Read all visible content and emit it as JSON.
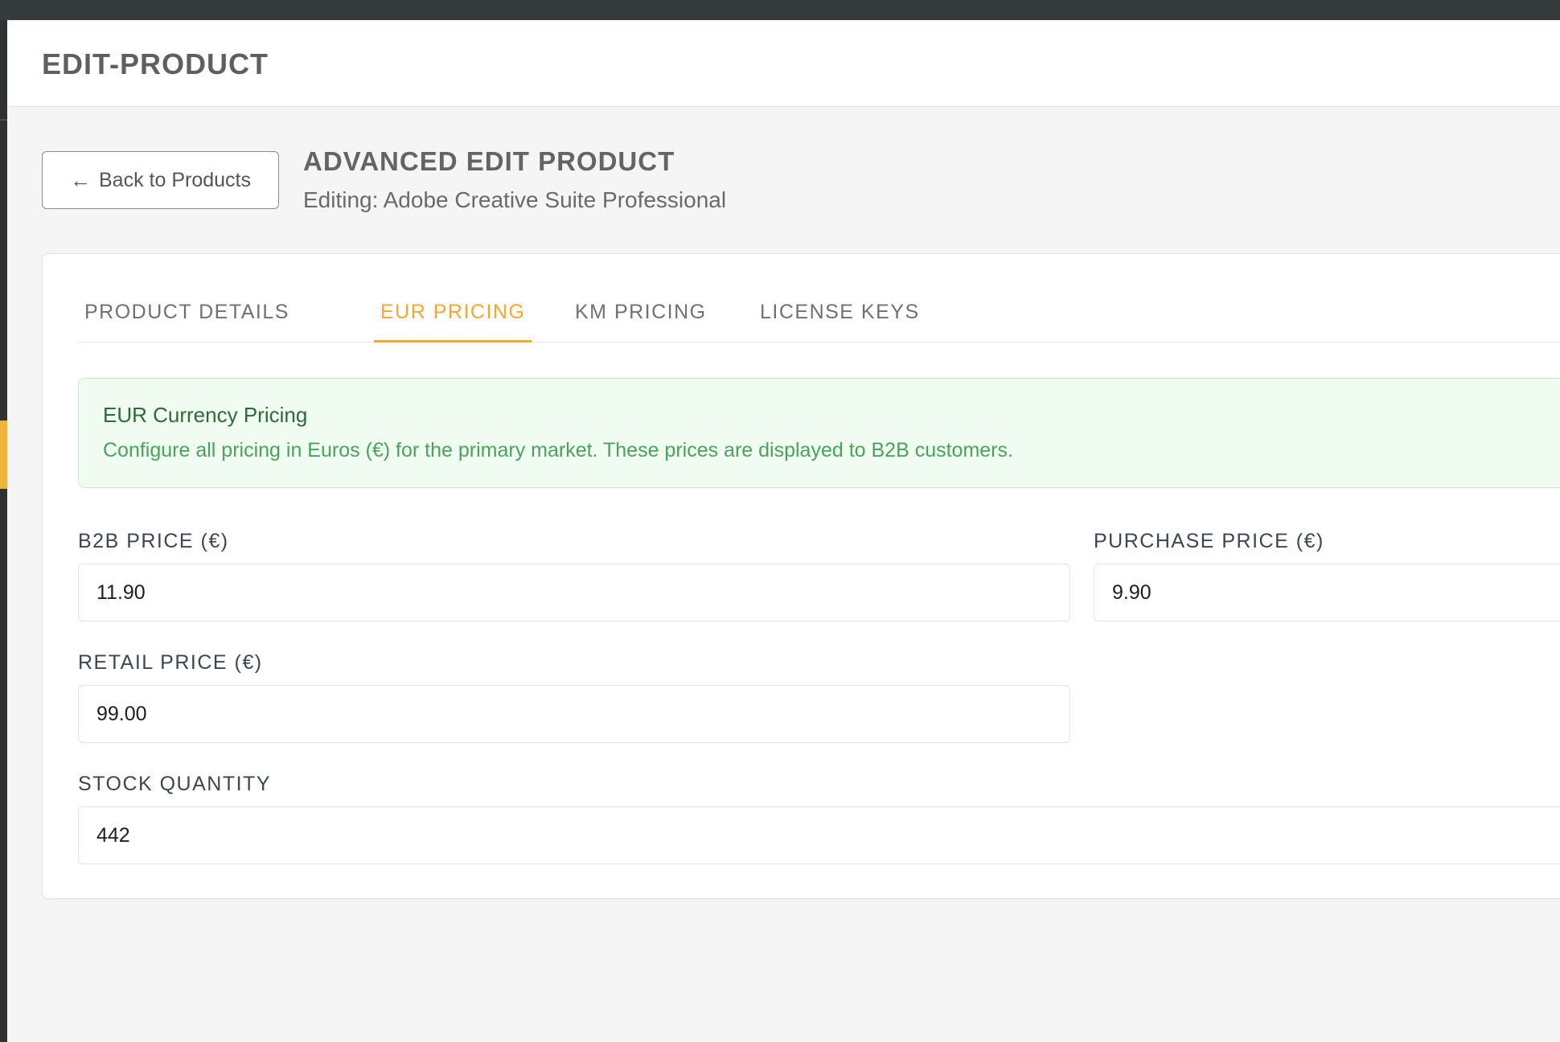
{
  "header": {
    "title": "EDIT-PRODUCT"
  },
  "back_button": {
    "label": "Back to Products"
  },
  "page": {
    "heading": "ADVANCED EDIT PRODUCT",
    "subheading": "Editing: Adobe Creative Suite Professional"
  },
  "tabs": [
    {
      "label": "PRODUCT DETAILS",
      "active": false
    },
    {
      "label": "EUR PRICING",
      "active": true
    },
    {
      "label": "KM PRICING",
      "active": false
    },
    {
      "label": "LICENSE KEYS",
      "active": false
    }
  ],
  "info_box": {
    "title": "EUR Currency Pricing",
    "text": "Configure all pricing in Euros (€) for the primary market. These prices are displayed to B2B customers."
  },
  "fields": {
    "b2b_price": {
      "label": "B2B PRICE (€)",
      "value": "11.90"
    },
    "purchase_price": {
      "label": "PURCHASE PRICE (€)",
      "value": "9.90"
    },
    "retail_price": {
      "label": "RETAIL PRICE (€)",
      "value": "99.00"
    },
    "stock_quantity": {
      "label": "STOCK QUANTITY",
      "value": "442"
    }
  },
  "colors": {
    "accent": "#f0a92e",
    "topbar": "#353a3d",
    "info_bg": "#f0fbf1",
    "info_title": "#2d6a3a",
    "info_text": "#4aa35a"
  }
}
